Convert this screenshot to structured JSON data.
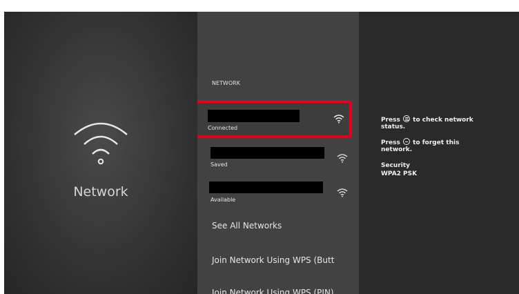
{
  "page": {
    "title": "Network"
  },
  "menu": {
    "section_label": "NETWORK",
    "networks": [
      {
        "status": "Connected",
        "signal_icon": "wifi-icon"
      },
      {
        "status": "Saved",
        "signal_icon": "wifi-icon"
      },
      {
        "status": "Available",
        "signal_icon": "wifi-icon"
      }
    ],
    "see_all": "See All Networks",
    "join_wps_button": "Join Network Using WPS (Butt",
    "join_wps_pin": "Join Network Using WPS (PIN)"
  },
  "help": {
    "check_prefix": "Press",
    "check_suffix": "to check network",
    "check_line2": "status.",
    "forget_prefix": "Press",
    "forget_suffix": "to forget this",
    "forget_line2": "network.",
    "security_label": "Security",
    "security_value": "WPA2 PSK"
  },
  "colors": {
    "focus": "#e3001b"
  }
}
